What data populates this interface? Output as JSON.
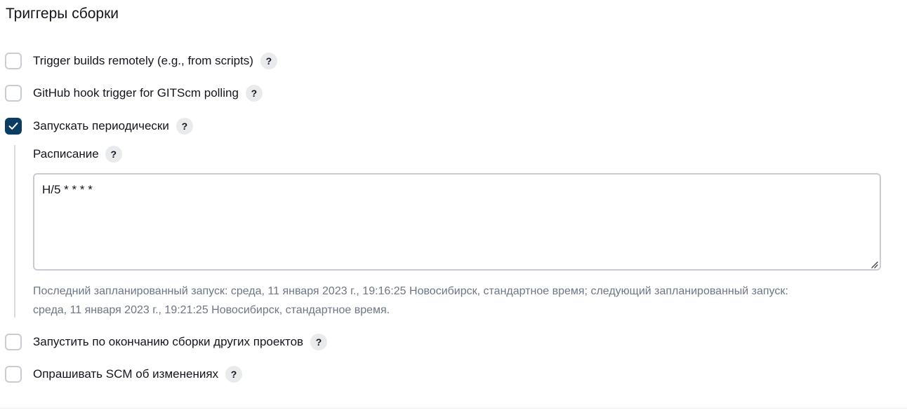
{
  "section": {
    "title": "Триггеры сборки"
  },
  "triggers": [
    {
      "label": "Trigger builds remotely (e.g., from scripts)",
      "checked": false,
      "help": "?"
    },
    {
      "label": "GitHub hook trigger for GITScm polling",
      "checked": false,
      "help": "?"
    },
    {
      "label": "Запускать периодически",
      "checked": true,
      "help": "?"
    },
    {
      "label": "Запустить по окончанию сборки других проектов",
      "checked": false,
      "help": "?"
    },
    {
      "label": "Опрашивать SCM об изменениях",
      "checked": false,
      "help": "?"
    }
  ],
  "schedule": {
    "label": "Расписание",
    "help": "?",
    "value": "H/5 * * * *",
    "info_line1": "Последний запланированный запуск: среда, 11 января 2023 г., 19:16:25 Новосибирск, стандартное время; следующий запланированный запуск:",
    "info_line2": "среда, 11 января 2023 г., 19:21:25 Новосибирск, стандартное время."
  },
  "icons": {
    "checkmark": "checkmark-icon",
    "help": "question-mark-icon",
    "resize": "resize-grip-icon"
  },
  "colors": {
    "checked_bg": "#0b3d62",
    "checkbox_border": "#c8cdd3",
    "help_bg": "#e9eaec",
    "info_text": "#6e7584"
  }
}
